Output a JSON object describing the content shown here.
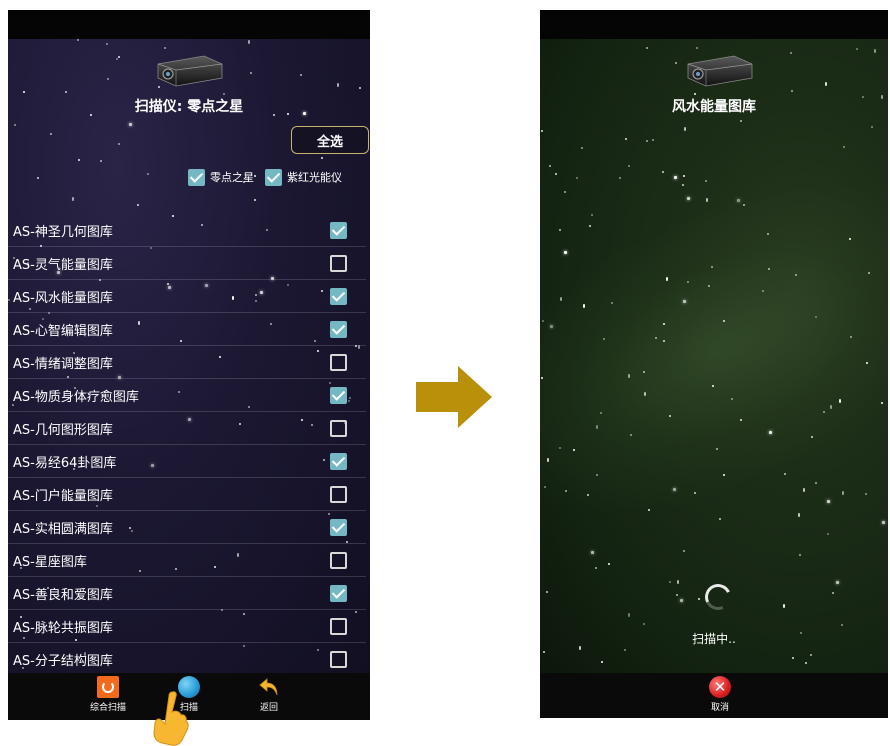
{
  "left_screen": {
    "title": "扫描仪: 零点之星",
    "select_all_label": "全选",
    "devices": [
      {
        "label": "零点之星",
        "checked": true
      },
      {
        "label": "紫红光能仪",
        "checked": true
      }
    ],
    "libraries": [
      {
        "label": "AS-神圣几何图库",
        "checked": true
      },
      {
        "label": "AS-灵气能量图库",
        "checked": false
      },
      {
        "label": "AS-风水能量图库",
        "checked": true
      },
      {
        "label": "AS-心智编辑图库",
        "checked": true
      },
      {
        "label": "AS-情绪调整图库",
        "checked": false
      },
      {
        "label": "AS-物质身体疗愈图库",
        "checked": true
      },
      {
        "label": "AS-几何图形图库",
        "checked": false
      },
      {
        "label": "AS-易经64卦图库",
        "checked": true
      },
      {
        "label": "AS-门户能量图库",
        "checked": false
      },
      {
        "label": "AS-实相圆满图库",
        "checked": true
      },
      {
        "label": "AS-星座图库",
        "checked": false
      },
      {
        "label": "AS-善良和爱图库",
        "checked": true
      },
      {
        "label": "AS-脉轮共振图库",
        "checked": false
      },
      {
        "label": "AS-分子结构图库",
        "checked": false
      }
    ],
    "bottom_nav": {
      "comprehensive_scan": "综合扫描",
      "scan": "扫描",
      "back": "返回"
    }
  },
  "right_screen": {
    "title": "风水能量图库",
    "status": "扫描中..",
    "cancel_label": "取消"
  },
  "colors": {
    "checkbox_on": "#74b8c4",
    "arrow": "#b8900a",
    "select_all_border": "#c9b26a",
    "orange_icon": "#f26a1b"
  },
  "icons": {
    "projector": "projector-icon",
    "comprehensive_scan": "orange-square-icon",
    "scan": "globe-icon",
    "back": "return-arrow-icon",
    "cancel": "cancel-x-icon",
    "pointer": "pointing-hand-icon",
    "transition": "right-arrow-icon"
  }
}
